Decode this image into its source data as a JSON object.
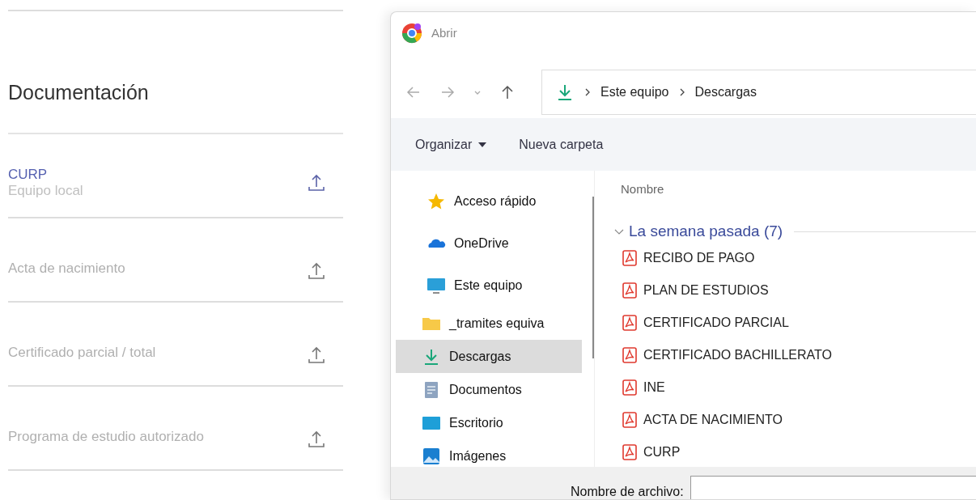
{
  "documents": {
    "title": "Documentación",
    "items": [
      {
        "label": "CURP",
        "subtitle": "Equipo local",
        "selected": true
      },
      {
        "label": "Acta de nacimiento",
        "selected": false
      },
      {
        "label": "Certificado parcial / total",
        "selected": false
      },
      {
        "label": "Programa de estudio autorizado",
        "selected": false
      }
    ]
  },
  "dialog": {
    "title": "Abrir",
    "breadcrumb": [
      "Este equipo",
      "Descargas"
    ],
    "toolbar": {
      "organize": "Organizar",
      "new_folder": "Nueva carpeta"
    },
    "nav_pane": [
      {
        "label": "Acceso rápido",
        "kind": "star",
        "selected": false
      },
      {
        "label": "OneDrive",
        "kind": "cloud",
        "selected": false
      },
      {
        "label": "Este equipo",
        "kind": "monitor",
        "selected": false,
        "children": [
          {
            "label": "_tramites equiva",
            "kind": "folder",
            "selected": false
          },
          {
            "label": "Descargas",
            "kind": "download",
            "selected": true
          },
          {
            "label": "Documentos",
            "kind": "document",
            "selected": false
          },
          {
            "label": "Escritorio",
            "kind": "desktop",
            "selected": false
          },
          {
            "label": "Imágenes",
            "kind": "image",
            "selected": false
          }
        ]
      }
    ],
    "column_header": "Nombre",
    "group": {
      "label": "La semana pasada (7)",
      "expanded": true
    },
    "files": [
      "RECIBO DE PAGO",
      "PLAN DE ESTUDIOS",
      "CERTIFICADO PARCIAL",
      "CERTIFICADO BACHILLERATO",
      "INE",
      "ACTA DE NACIMIENTO",
      "CURP"
    ],
    "filename_label": "Nombre de archivo:"
  }
}
